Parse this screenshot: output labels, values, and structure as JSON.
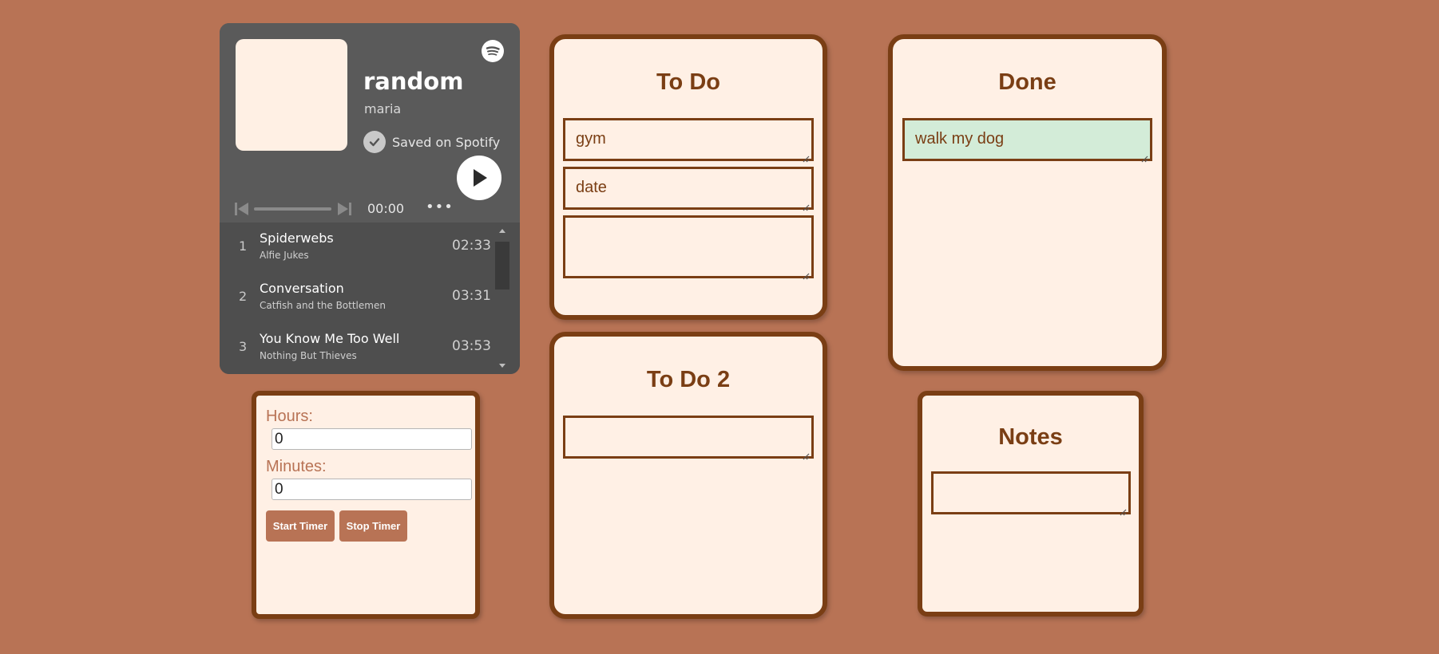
{
  "spotify": {
    "title": "random",
    "artist": "maria",
    "saved_label": "Saved on Spotify",
    "time": "00:00",
    "more_label": "•••",
    "progress_fraction": 0,
    "tracks": [
      {
        "num": "1",
        "title": "Spiderwebs",
        "artist": "Alfie Jukes",
        "duration": "02:33"
      },
      {
        "num": "2",
        "title": "Conversation",
        "artist": "Catfish and the Bottlemen",
        "duration": "03:31"
      },
      {
        "num": "3",
        "title": "You Know Me Too Well",
        "artist": "Nothing But Thieves",
        "duration": "03:53"
      }
    ]
  },
  "todo": {
    "title": "To Do",
    "tasks": [
      "gym",
      "date",
      ""
    ]
  },
  "todo2": {
    "title": "To Do 2",
    "tasks": [
      ""
    ]
  },
  "done": {
    "title": "Done",
    "tasks": [
      "walk my dog"
    ]
  },
  "notes": {
    "title": "Notes",
    "tasks": [
      ""
    ]
  },
  "timer": {
    "hours_label": "Hours:",
    "hours_value": "0",
    "minutes_label": "Minutes:",
    "minutes_value": "0",
    "start_label": "Start Timer",
    "stop_label": "Stop Timer"
  },
  "colors": {
    "background": "#b87355",
    "card_border": "#7a3e14",
    "card_fill": "#fff0e5",
    "done_fill": "#d3ecd8",
    "spotify_bg": "#545454"
  }
}
